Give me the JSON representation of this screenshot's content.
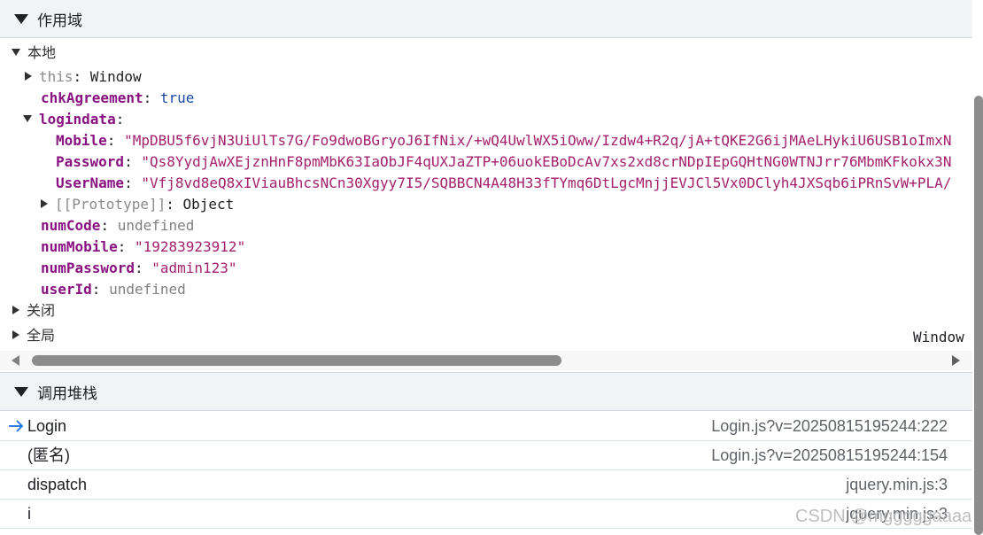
{
  "scope": {
    "header_title": "作用域",
    "local_label": "本地",
    "this_key": "this",
    "this_value": "Window",
    "chk_key": "chkAgreement",
    "chk_value": "true",
    "logindata_key": "logindata",
    "mobile_key": "Mobile",
    "mobile_value": "\"MpDBU5f6vjN3UiUlTs7G/Fo9dwoBGryoJ6IfNix/+wQ4UwlWX5iOww/Izdw4+R2q/jA+tQKE2G6ijMAeLHykiU6USB1oImxN",
    "password_key": "Password",
    "password_value": "\"Qs8YydjAwXEjznHnF8pmMbK63IaObJF4qUXJaZTP+06uokEBoDcAv7xs2xd8crNDpIEpGQHtNG0WTNJrr76MbmKFkokx3N",
    "username_key": "UserName",
    "username_value": "\"Vfj8vd8eQ8xIViauBhcsNCn30Xgyy7I5/SQBBCN4A48H33fTYmq6DtLgcMnjjEVJCl5Vx0DClyh4JXSqb6iPRnSvW+PLA/",
    "prototype_key": "[[Prototype]]",
    "prototype_value": "Object",
    "numcode_key": "numCode",
    "numcode_value": "undefined",
    "nummobile_key": "numMobile",
    "nummobile_value": "\"19283923912\"",
    "numpassword_key": "numPassword",
    "numpassword_value": "\"admin123\"",
    "userid_key": "userId",
    "userid_value": "undefined",
    "closure_label": "关闭",
    "global_label": "全局",
    "global_value": "Window"
  },
  "callstack": {
    "header_title": "调用堆栈",
    "frames": [
      {
        "fn": "Login",
        "loc": "Login.js?v=20250815195244:222"
      },
      {
        "fn": "(匿名)",
        "loc": "Login.js?v=20250815195244:154"
      },
      {
        "fn": "dispatch",
        "loc": "jquery.min.js:3"
      },
      {
        "fn": "i",
        "loc": "jquery.min.js:3"
      }
    ]
  },
  "watermark": "CSDN @mgggggaaaa"
}
